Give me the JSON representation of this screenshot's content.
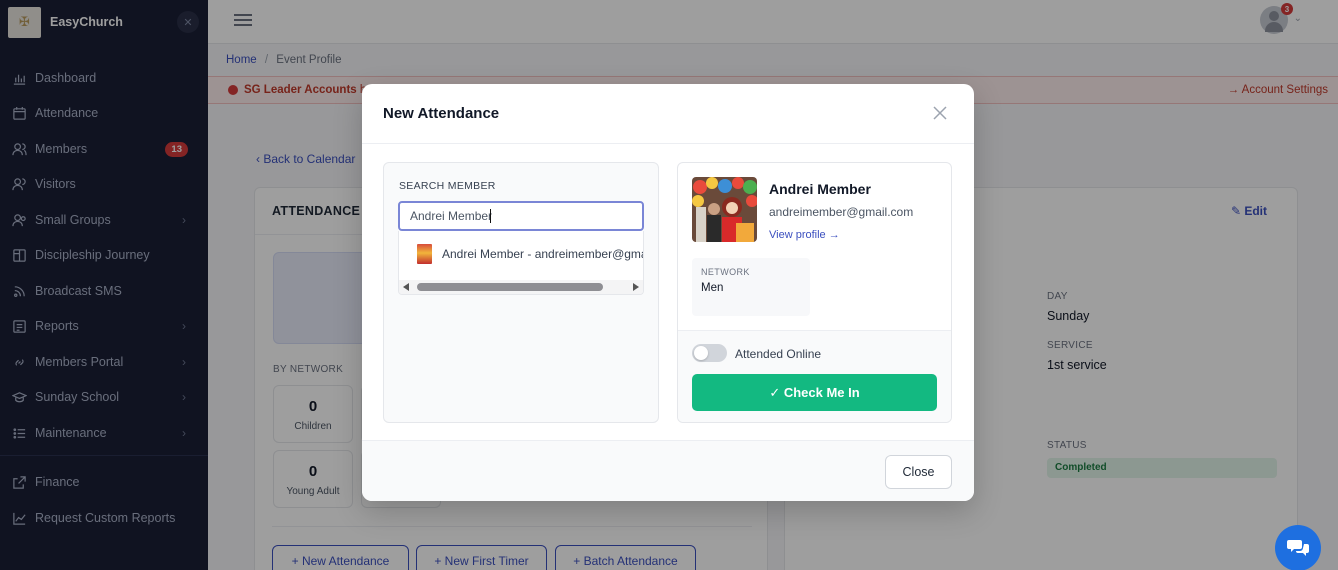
{
  "app": {
    "name": "EasyChurch"
  },
  "sidebar": {
    "items": [
      {
        "label": "Dashboard",
        "icon": "chart-bar-icon"
      },
      {
        "label": "Attendance",
        "icon": "calendar-icon"
      },
      {
        "label": "Members",
        "icon": "users-icon",
        "badge": "13"
      },
      {
        "label": "Visitors",
        "icon": "user-group-icon"
      },
      {
        "label": "Small Groups",
        "icon": "small-groups-icon",
        "chevron": "›"
      },
      {
        "label": "Discipleship Journey",
        "icon": "book-icon"
      },
      {
        "label": "Broadcast SMS",
        "icon": "rss-icon"
      },
      {
        "label": "Reports",
        "icon": "report-icon",
        "chevron": "›"
      },
      {
        "label": "Members Portal",
        "icon": "link-icon",
        "chevron": "›"
      },
      {
        "label": "Sunday School",
        "icon": "graduation-cap-icon",
        "chevron": "›"
      },
      {
        "label": "Maintenance",
        "icon": "list-icon",
        "chevron": "›"
      },
      {
        "label": "Finance",
        "icon": "external-icon"
      },
      {
        "label": "Request Custom Reports",
        "icon": "trend-icon"
      }
    ]
  },
  "topbar": {
    "notification_count": "3"
  },
  "breadcrumb": {
    "home": "Home",
    "separator": "/",
    "current": "Event Profile"
  },
  "alert": {
    "bold": "SG Leader Accounts",
    "text": " has",
    "link": "→ Account Settings"
  },
  "page": {
    "back_link": "‹  Back to Calendar",
    "left_card_title": "ATTENDANCE S",
    "by_network": "BY NETWORK",
    "tiles": [
      {
        "num": "0",
        "label": "Children"
      },
      {
        "num": "0",
        "label": "Young Adult"
      }
    ],
    "buttons": [
      "+  New Attendance",
      "+  New First Timer",
      "+  Batch Attendance"
    ],
    "edit": "Edit",
    "day_label": "DAY",
    "day_value": "Sunday",
    "service_label": "SERVICE",
    "service_value": "1st service",
    "status_label": "STATUS",
    "status_value": "Completed"
  },
  "modal": {
    "title": "New Attendance",
    "search": {
      "label": "SEARCH MEMBER",
      "value": "Andrei Member",
      "results": [
        "Andrei Member - andreimember@gmail.com"
      ]
    },
    "member": {
      "name": "Andrei Member",
      "email": "andreimember@gmail.com",
      "view_profile": "View profile →",
      "network_label": "NETWORK",
      "network_value": "Men",
      "attended_online_label": "Attended Online",
      "attended_online": false,
      "checkin_label": "✓ Check Me In"
    },
    "close_label": "Close"
  },
  "colors": {
    "sidebar_bg": "#1a1f36",
    "primary": "#3b4fbf",
    "success": "#13b981",
    "danger": "#d63b3b",
    "chat_fab": "#1e6fe0"
  }
}
